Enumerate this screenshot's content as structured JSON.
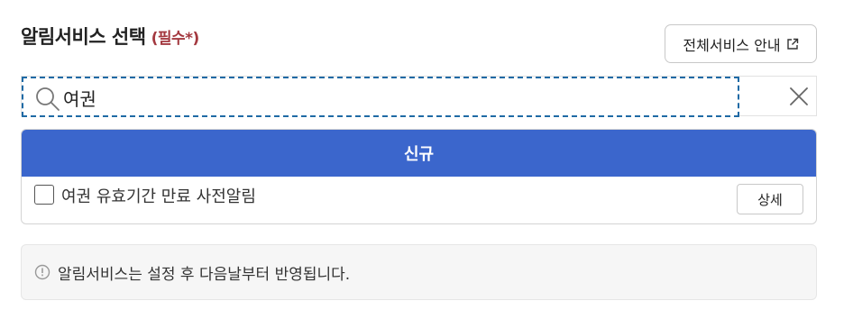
{
  "header": {
    "title": "알림서비스 선택",
    "required_label": "(필수*)",
    "all_services_button": "전체서비스 안내"
  },
  "search": {
    "value": "여권",
    "placeholder": ""
  },
  "results": {
    "category_label": "신규",
    "items": [
      {
        "label": "여권 유효기간 만료 사전알림",
        "checked": false,
        "detail_button": "상세"
      }
    ]
  },
  "notice": {
    "text": "알림서비스는 설정 후 다음날부터 반영됩니다."
  },
  "colors": {
    "accent": "#3b66cc",
    "required": "#a3383f",
    "focus_outline": "#1f6aa5"
  }
}
